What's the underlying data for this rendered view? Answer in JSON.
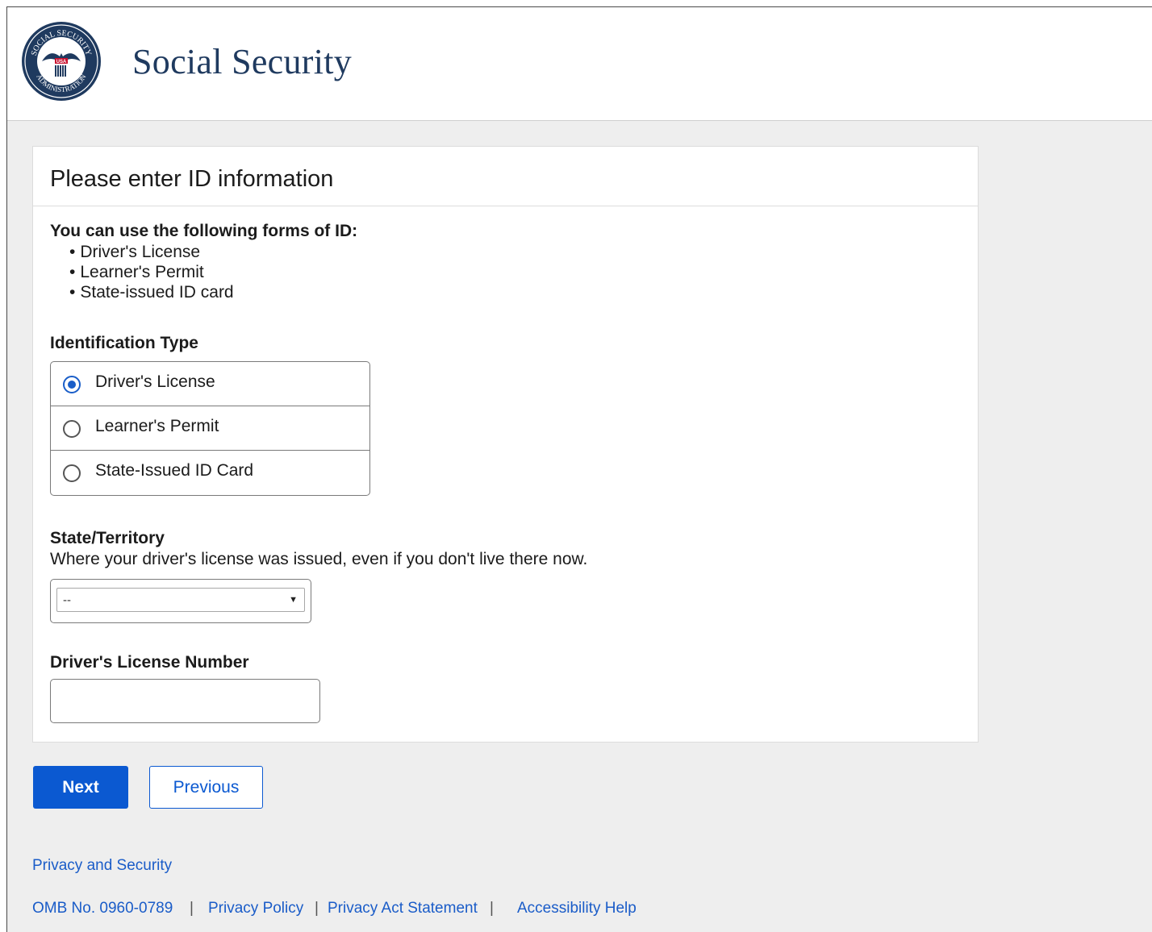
{
  "header": {
    "site_title": "Social Security",
    "seal_text_top": "SOCIAL SECURITY",
    "seal_text_bottom": "ADMINISTRATION",
    "seal_badge": "USA"
  },
  "card": {
    "heading": "Please enter ID information",
    "intro": "You can use the following forms of ID:",
    "id_forms": [
      "Driver's License",
      "Learner's Permit",
      "State-issued ID card"
    ]
  },
  "id_type": {
    "label": "Identification Type",
    "options": [
      {
        "label": "Driver's License",
        "checked": true
      },
      {
        "label": "Learner's Permit",
        "checked": false
      },
      {
        "label": "State-Issued ID Card",
        "checked": false
      }
    ]
  },
  "state": {
    "label": "State/Territory",
    "hint": "Where your driver's license was issued, even if you don't live there now.",
    "selected": "--"
  },
  "license_number": {
    "label": "Driver's License Number",
    "value": ""
  },
  "buttons": {
    "next": "Next",
    "previous": "Previous"
  },
  "footer": {
    "privacy_security": "Privacy and Security",
    "omb": "OMB No. 0960-0789",
    "privacy_policy": "Privacy Policy",
    "privacy_act": "Privacy Act Statement",
    "accessibility": "Accessibility Help",
    "separator": "|"
  },
  "colors": {
    "brand_navy": "#1f3a5f",
    "primary_blue": "#0b59d1",
    "link_blue": "#1a5cc8"
  }
}
